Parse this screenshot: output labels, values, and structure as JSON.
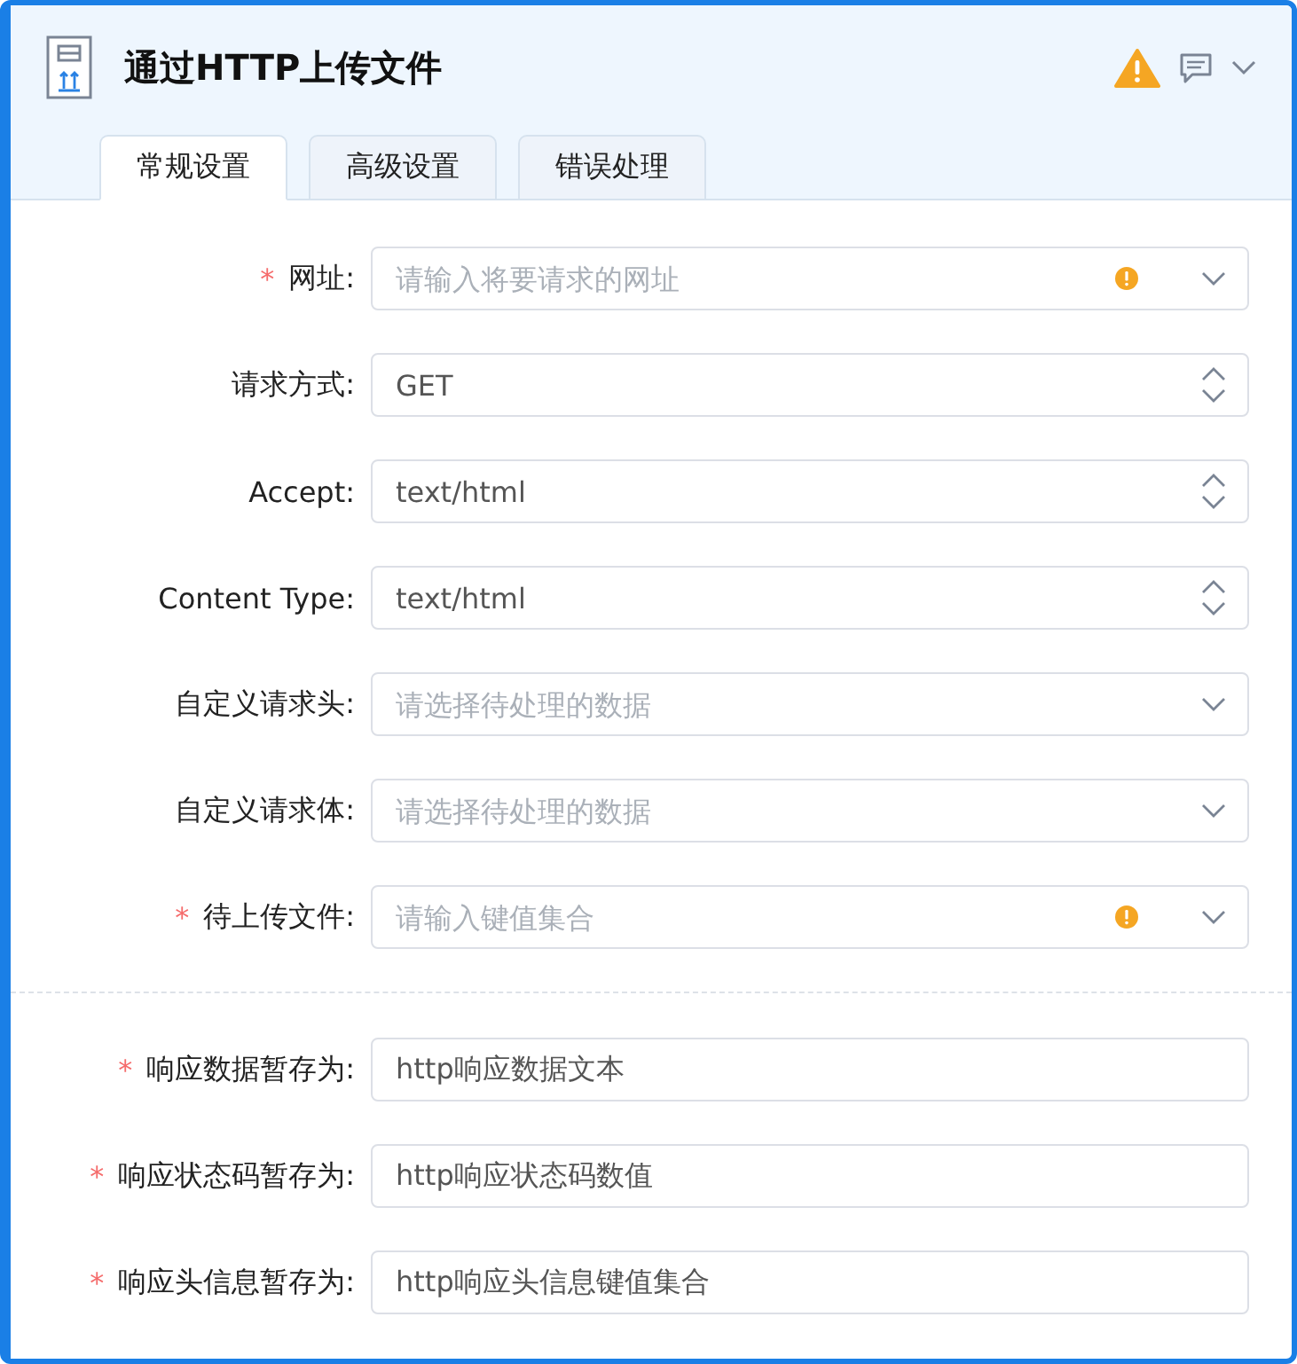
{
  "header": {
    "title": "通过HTTP上传文件",
    "warning": true
  },
  "tabs": [
    {
      "label": "常规设置",
      "selected": true
    },
    {
      "label": "高级设置",
      "selected": false
    },
    {
      "label": "错误处理",
      "selected": false
    }
  ],
  "sections": [
    {
      "fields": [
        {
          "label": "网址:",
          "required": "*",
          "kind": "select",
          "placeholder": "请输入将要请求的网址",
          "warning": true
        },
        {
          "label": "请求方式:",
          "kind": "spinner",
          "value": "GET",
          "warning": false
        },
        {
          "label": "Accept:",
          "kind": "spinner",
          "value": "text/html",
          "warning": false
        },
        {
          "label": "Content Type:",
          "kind": "spinner",
          "value": "text/html",
          "warning": false
        },
        {
          "label": "自定义请求头:",
          "kind": "select",
          "placeholder": "请选择待处理的数据",
          "warning": false
        },
        {
          "label": "自定义请求体:",
          "kind": "select",
          "placeholder": "请选择待处理的数据",
          "warning": false
        },
        {
          "label": "待上传文件:",
          "required": "*",
          "kind": "select",
          "placeholder": "请输入键值集合",
          "warning": true
        }
      ]
    },
    {
      "fields": [
        {
          "label": "响应数据暂存为:",
          "required": "*",
          "kind": "text",
          "value": "http响应数据文本",
          "warning": false
        },
        {
          "label": "响应状态码暂存为:",
          "required": "*",
          "kind": "text",
          "value": "http响应状态码数值",
          "warning": false
        },
        {
          "label": "响应头信息暂存为:",
          "required": "*",
          "kind": "text",
          "value": "http响应头信息键值集合",
          "warning": false
        }
      ]
    }
  ]
}
